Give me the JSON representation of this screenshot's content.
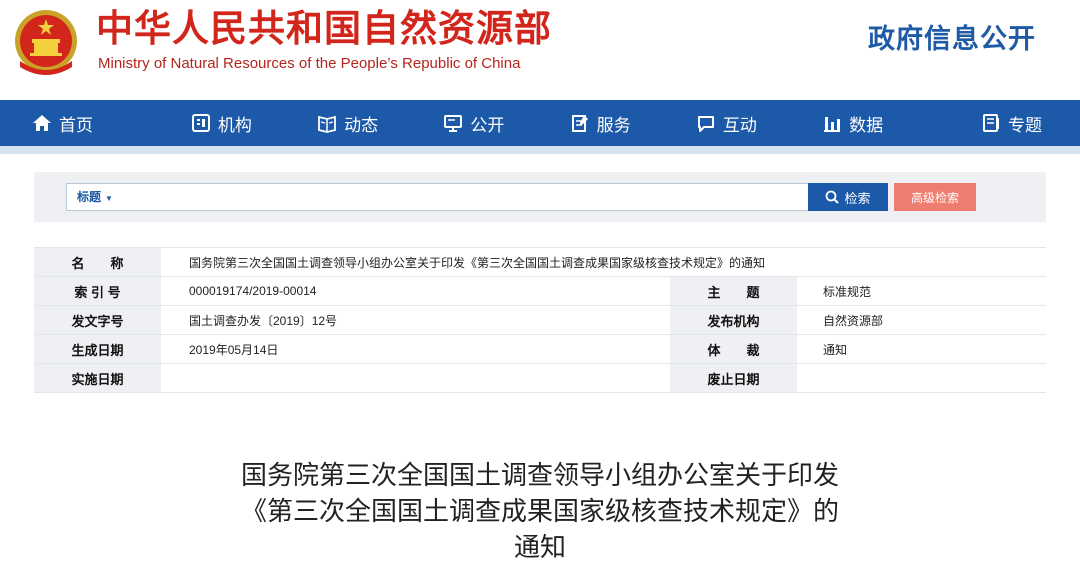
{
  "header": {
    "brand_cn": "中华人民共和国自然资源部",
    "brand_en": "Ministry of Natural Resources of the People’s Republic of China",
    "gov_open": "政府信息公开",
    "brand_color": "#d2261c",
    "accent_color": "#1c59a8"
  },
  "nav": {
    "items": [
      {
        "label": "首页",
        "icon": "home-icon"
      },
      {
        "label": "机构",
        "icon": "org-icon"
      },
      {
        "label": "动态",
        "icon": "news-icon"
      },
      {
        "label": "公开",
        "icon": "monitor-icon"
      },
      {
        "label": "服务",
        "icon": "service-icon"
      },
      {
        "label": "互动",
        "icon": "chat-icon"
      },
      {
        "label": "数据",
        "icon": "chart-icon"
      },
      {
        "label": "专题",
        "icon": "topic-icon"
      }
    ]
  },
  "search": {
    "field": "标题",
    "value": "",
    "search_label": "检索",
    "advanced_label": "高级检索"
  },
  "info": {
    "name_label": "名　　称",
    "name_value": "国务院第三次全国国土调查领导小组办公室关于印发《第三次全国国土调查成果国家级核查技术规定》的通知",
    "index_label": "索 引 号",
    "index_value": "000019174/2019-00014",
    "subject_label": "主　　题",
    "subject_value": "标准规范",
    "doc_no_label": "发文字号",
    "doc_no_value": "国土调查办发〔2019〕12号",
    "publisher_label": "发布机构",
    "publisher_value": "自然资源部",
    "created_label": "生成日期",
    "created_value": "2019年05月14日",
    "genre_label": "体　　裁",
    "genre_value": "通知",
    "effective_label": "实施日期",
    "effective_value": "",
    "abolish_label": "废止日期",
    "abolish_value": ""
  },
  "article": {
    "title_line1": "国务院第三次全国国土调查领导小组办公室关于印发",
    "title_line2": "《第三次全国国土调查成果国家级核查技术规定》的",
    "title_line3": "通知"
  }
}
